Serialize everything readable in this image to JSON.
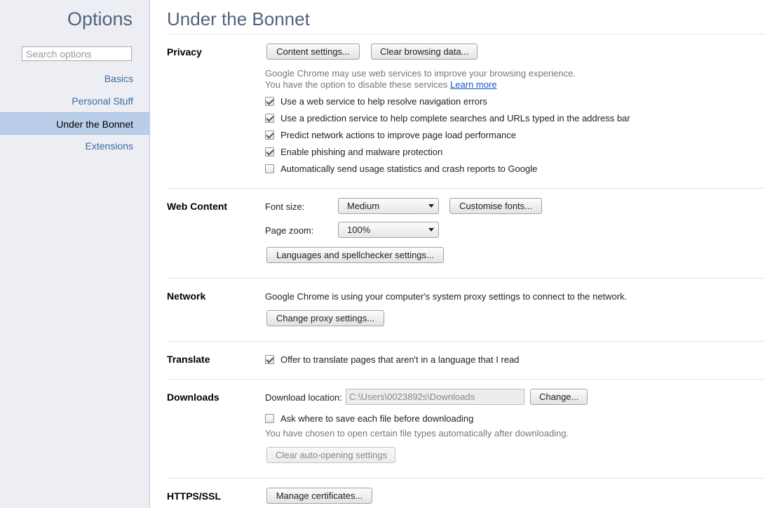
{
  "sidebar": {
    "title": "Options",
    "search_placeholder": "Search options",
    "items": [
      {
        "label": "Basics"
      },
      {
        "label": "Personal Stuff"
      },
      {
        "label": "Under the Bonnet"
      },
      {
        "label": "Extensions"
      }
    ],
    "selected": "Under the Bonnet"
  },
  "main": {
    "title": "Under the Bonnet",
    "privacy": {
      "title": "Privacy",
      "content_settings_label": "Content settings...",
      "clear_browsing_label": "Clear browsing data...",
      "note_line1": "Google Chrome may use web services to improve your browsing experience.",
      "note_line2": "You have the option to disable these services",
      "learn_more": "Learn more",
      "options": [
        {
          "label": "Use a web service to help resolve navigation errors",
          "checked": true
        },
        {
          "label": "Use a prediction service to help complete searches and URLs typed in the address bar",
          "checked": true
        },
        {
          "label": "Predict network actions to improve page load performance",
          "checked": true
        },
        {
          "label": "Enable phishing and malware protection",
          "checked": true
        },
        {
          "label": "Automatically send usage statistics and crash reports to Google",
          "checked": false
        }
      ]
    },
    "web_content": {
      "title": "Web Content",
      "font_size_label": "Font size:",
      "font_size_value": "Medium",
      "customise_fonts_label": "Customise fonts...",
      "page_zoom_label": "Page zoom:",
      "page_zoom_value": "100%",
      "languages_label": "Languages and spellchecker settings..."
    },
    "network": {
      "title": "Network",
      "description": "Google Chrome is using your computer's system proxy settings to connect to the network.",
      "change_proxy_label": "Change proxy settings..."
    },
    "translate": {
      "title": "Translate",
      "offer_label": "Offer to translate pages that aren't in a language that I read",
      "offer_checked": true
    },
    "downloads": {
      "title": "Downloads",
      "location_label": "Download location:",
      "location_value": "C:\\Users\\0023892s\\Downloads",
      "change_label": "Change...",
      "ask_label": "Ask where to save each file before downloading",
      "ask_checked": false,
      "auto_open_note": "You have chosen to open certain file types automatically after downloading.",
      "clear_auto_open_label": "Clear auto-opening settings"
    },
    "https": {
      "title": "HTTPS/SSL",
      "manage_certs_label": "Manage certificates..."
    }
  }
}
